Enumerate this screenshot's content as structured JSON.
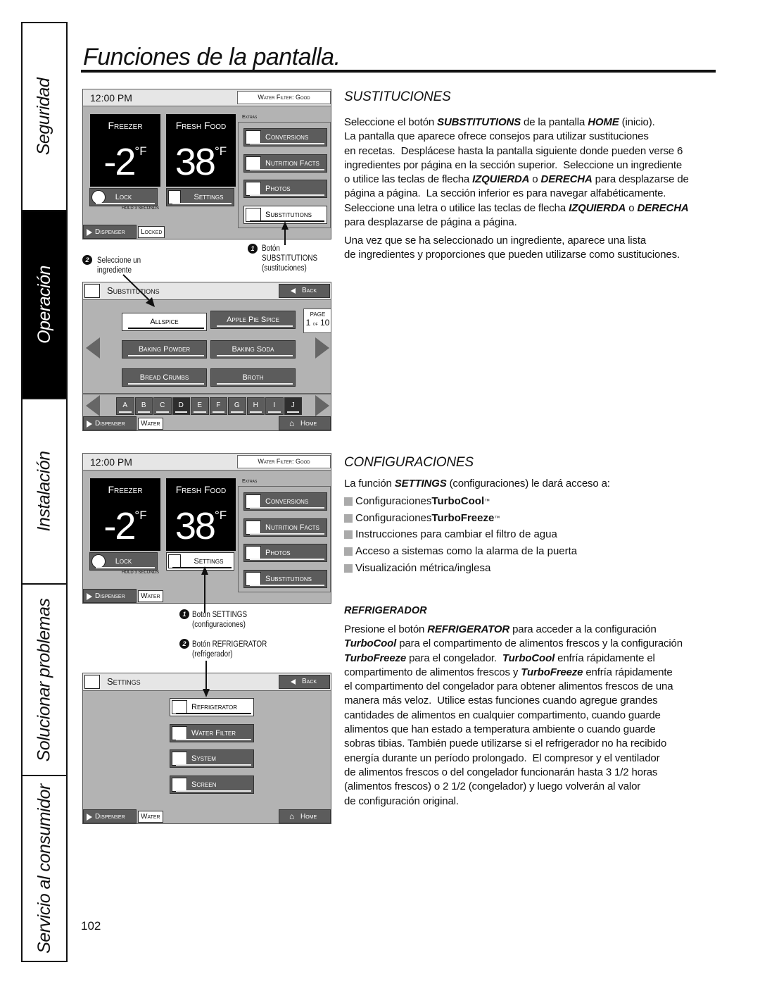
{
  "side_tabs": [
    {
      "label": "Seguridad",
      "active": false
    },
    {
      "label": "Operación",
      "active": true
    },
    {
      "label": "Instalación",
      "active": false
    },
    {
      "label": "Solucionar problemas",
      "active": false
    },
    {
      "label": "Servicio al consumidor",
      "active": false
    }
  ],
  "page_title": "Funciones de la pantalla.",
  "page_number": "102",
  "home_screen": {
    "clock": "12:00 PM",
    "water_filter": "Water Filter: Good",
    "freezer_label": "Freezer",
    "freezer_temp": "-2",
    "fresh_label": "Fresh Food",
    "fresh_temp": "38",
    "unit": "°F",
    "lock": "Lock",
    "hold": "HOLD 3 SECONDS",
    "settings": "Settings",
    "extras_label": "Extras",
    "extras": [
      "Conversions",
      "Nutrition Facts",
      "Photos",
      "Substitutions"
    ],
    "dispenser": "Dispenser"
  },
  "screen1": {
    "dispenser_state": "Locked",
    "selected": "Substitutions"
  },
  "screen3": {
    "dispenser_state": "Water",
    "selected": "Settings"
  },
  "subs_screen": {
    "title": "Substitutions",
    "back": "Back",
    "items": [
      "Allspice",
      "Apple Pie Spice",
      "Baking Powder",
      "Baking Soda",
      "Bread Crumbs",
      "Broth"
    ],
    "selected": "Allspice",
    "page_label": "PAGE",
    "page_current": "1",
    "page_of": "of",
    "page_total": "10",
    "letters": [
      "A",
      "B",
      "C",
      "D",
      "E",
      "F",
      "G",
      "H",
      "I",
      "J"
    ],
    "dark_letters": [
      "D",
      "J"
    ],
    "dispenser": "Dispenser",
    "dispenser_state": "Water",
    "home": "Home"
  },
  "settings_screen": {
    "title": "Settings",
    "back": "Back",
    "items": [
      "Refrigerator",
      "Water Filter",
      "System",
      "Screen"
    ],
    "selected": "Refrigerator",
    "dispenser": "Dispenser",
    "dispenser_state": "Water",
    "home": "Home"
  },
  "callouts": {
    "subs_1_num": "1",
    "subs_1_lines": [
      "Botón",
      "SUBSTITUTIONS",
      "(sustituciones)"
    ],
    "subs_2_num": "2",
    "subs_2_lines": [
      "Seleccione un",
      "ingrediente"
    ],
    "set_1_num": "1",
    "set_1_lines": [
      "Botón SETTINGS",
      "(configuraciones)"
    ],
    "set_2_num": "2",
    "set_2_lines": [
      "Botón REFRIGERATOR",
      "(refrigerador)"
    ]
  },
  "sustituciones": {
    "heading": "SUSTITUCIONES",
    "para1": [
      [
        "Seleccione el botón ",
        {
          "em": "SUBSTITUTIONS"
        },
        " de la pantalla ",
        {
          "em": "HOME"
        },
        " (inicio)."
      ],
      [
        "La pantalla que aparece ofrece consejos para utilizar sustituciones"
      ],
      [
        "en recetas.  Desplácese hasta la pantalla siguiente donde pueden verse 6"
      ],
      [
        "ingredientes por página en la sección superior.  Seleccione un ingrediente"
      ],
      [
        "o utilice las teclas de flecha ",
        {
          "em": "IZQUIERDA"
        },
        " o ",
        {
          "em": "DERECHA"
        },
        " para desplazarse de"
      ],
      [
        "página a página.  La sección inferior es para navegar alfabéticamente."
      ],
      [
        "Seleccione una letra o utilice las teclas de flecha ",
        {
          "em": "IZQUIERDA"
        },
        " o ",
        {
          "em": "DERECHA"
        }
      ],
      [
        "para desplazarse de página a página."
      ]
    ],
    "para2": [
      [
        "Una vez que se ha seleccionado un ingrediente, aparece una lista"
      ],
      [
        "de ingredientes y proporciones que pueden utilizarse como sustituciones."
      ]
    ]
  },
  "configuraciones": {
    "heading": "CONFIGURACIONES",
    "intro": [
      [
        "La función ",
        {
          "em": "SETTINGS"
        },
        " (configuraciones) le dará acceso a:"
      ]
    ],
    "bullets": [
      [
        "Configuraciones ",
        {
          "em": "TurboCool"
        },
        {
          "tm": "™"
        }
      ],
      [
        "Configuraciones ",
        {
          "em": "TurboFreeze"
        },
        {
          "tm": "™"
        }
      ],
      [
        "Instrucciones para cambiar el filtro de agua"
      ],
      [
        "Acceso a sistemas como la alarma de la puerta"
      ],
      [
        "Visualización métrica/inglesa"
      ]
    ],
    "subheading": "REFRIGERADOR",
    "para": [
      [
        "Presione el botón ",
        {
          "em": "REFRIGERATOR"
        },
        " para acceder a la configuración"
      ],
      [
        {
          "em": "TurboCool"
        },
        " para el compartimento de alimentos frescos y la configuración"
      ],
      [
        {
          "em": "TurboFreeze"
        },
        " para el congelador.  ",
        {
          "em": "TurboCool"
        },
        " enfría rápidamente el"
      ],
      [
        "compartimento de alimentos frescos y ",
        {
          "em": "TurboFreeze"
        },
        " enfría rápidamente"
      ],
      [
        "el compartimento del congelador para obtener alimentos frescos de una"
      ],
      [
        "manera más veloz.  Utilice estas funciones cuando agregue grandes"
      ],
      [
        "cantidades de alimentos en cualquier compartimento, cuando guarde"
      ],
      [
        "alimentos que han estado a temperatura ambiente o cuando guarde"
      ],
      [
        "sobras tibias. También puede utilizarse si el refrigerador no ha recibido"
      ],
      [
        "energía durante un período prolongado.  El compresor y el ventilador"
      ],
      [
        "de alimentos frescos o del congelador funcionarán hasta 3 1/2 horas"
      ],
      [
        "(alimentos frescos) o 2 1/2 (congelador) y luego volverán al valor"
      ],
      [
        "de configuración original."
      ]
    ]
  },
  "colors": {
    "panel_gray": "#b3b3b3",
    "button_gray": "#5c5c5c",
    "active_tab": "#000000"
  }
}
